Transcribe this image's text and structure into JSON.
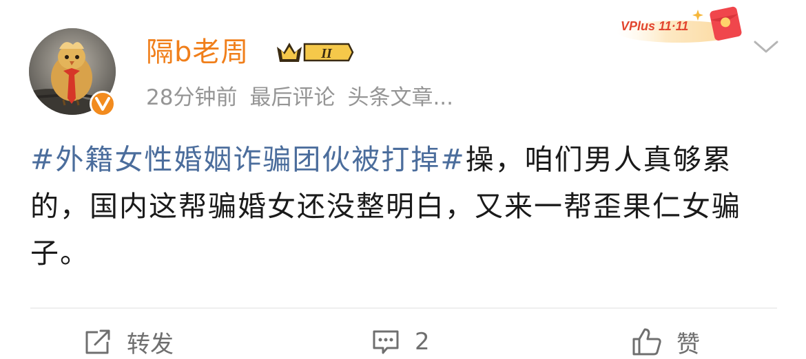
{
  "post": {
    "username": "隔b老周",
    "vip_level": "II",
    "meta": {
      "time": "28分钟前",
      "last_comment": "最后评论",
      "source": "头条文章..."
    },
    "promo_label": "VPlus 11·11",
    "content": {
      "hashtag": "#外籍女性婚姻诈骗团伙被打掉#",
      "text": "操，咱们男人真够累的，国内这帮骗婚女还没整明白，又来一帮歪果仁女骗子。"
    },
    "actions": {
      "repost_label": "转发",
      "comment_count": "2",
      "like_label": "赞"
    },
    "colors": {
      "username": "#f07f1b",
      "hashtag": "#4b6d9c",
      "meta": "#959595",
      "verified": "#f28b1e"
    },
    "icons": {
      "repost": "share-square-icon",
      "comment": "comment-bubble-icon",
      "like": "thumbs-up-icon",
      "more": "chevron-down-icon",
      "verified": "verified-v-icon"
    }
  }
}
